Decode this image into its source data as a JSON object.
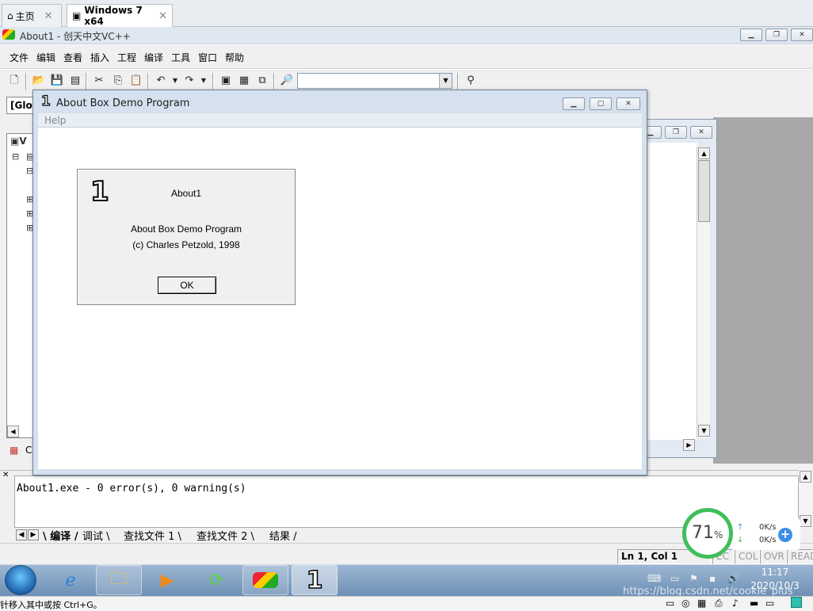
{
  "host": {
    "tabs": [
      {
        "label": "主页",
        "icon": "home-icon"
      },
      {
        "label": "Windows 7 x64",
        "icon": "vm-icon"
      }
    ],
    "close_glyph": "✕",
    "status_text": "针移入其中或按 Ctrl+G。"
  },
  "vc": {
    "title": "About1 - 创天中文VC++",
    "menu": [
      "文件",
      "编辑",
      "查看",
      "插入",
      "工程",
      "编译",
      "工具",
      "窗口",
      "帮助"
    ],
    "glob_combo": "[Glob",
    "tree_root_label": "V",
    "tree_tab_label": "C",
    "output_text": "About1.exe - 0 error(s), 0 warning(s)",
    "output_tabs": [
      "编译",
      "调试",
      "查找文件 1",
      "查找文件 2",
      "结果"
    ],
    "status": {
      "position": "Ln 1, Col 1",
      "rec": "EC",
      "col": "COL",
      "ovr": "OVR",
      "read": "READ"
    }
  },
  "about_window": {
    "title": "About Box Demo Program",
    "menu_help": "Help"
  },
  "dialog": {
    "icon_glyph": "1",
    "app_name": "About1",
    "line1": "About Box Demo Program",
    "line2": "(c) Charles Petzold, 1998",
    "ok_label": "OK"
  },
  "speed_widget": {
    "percent": "71",
    "percent_sign": "%",
    "up": "0K/s",
    "down": "0K/s",
    "color": "#3fbf5a"
  },
  "taskbar": {
    "time": "11:17",
    "date": "2020/10/3",
    "active_glyph": "1"
  },
  "watermark": "https://blog.csdn.net/cookie_plus"
}
